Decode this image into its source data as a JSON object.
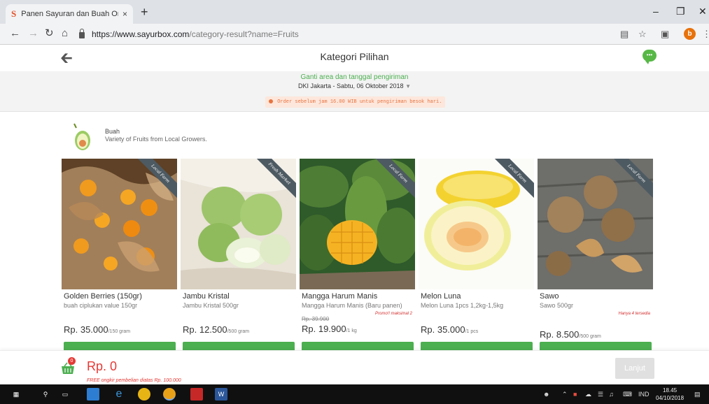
{
  "browser": {
    "tab_title": "Panen Sayuran dan Buah Organi",
    "tab_favicon": "S",
    "tab_close": "×",
    "new_tab": "+",
    "url_host": "https://www.sayurbox.com",
    "url_path": "/category-result?name=Fruits",
    "profile_initial": "b"
  },
  "header": {
    "title": "Kategori Pilihan"
  },
  "delivery": {
    "change_label": "Ganti area dan tanggal pengiriman",
    "location_date": "DKI Jakarta - Sabtu, 06 Oktober 2018",
    "notice": "Order sebelum jam 16.00 WIB untuk pengiriman besok hari."
  },
  "category": {
    "name": "Buah",
    "description": "Variety of Fruits from Local Growers."
  },
  "products": [
    {
      "badge": "Local Farm",
      "name": "Golden Berries (150gr)",
      "description": "buah ciplukan value 150gr",
      "price": "Rp. 35.000",
      "unit": "/150 gram"
    },
    {
      "badge": "Fresh Market",
      "name": "Jambu Kristal",
      "description": "Jambu Kristal 500gr",
      "price": "Rp. 12.500",
      "unit": "/500 gram"
    },
    {
      "badge": "Local Farm",
      "name": "Mangga Harum Manis",
      "description": "Mangga Harum Manis (Baru panen)",
      "promo": "Promo!! maksimal 2",
      "old_price": "Rp. 39.900",
      "price": "Rp. 19.900",
      "unit": "/1 kg"
    },
    {
      "badge": "Local Farm",
      "name": "Melon Luna",
      "description": "Melon Luna 1pcs 1,2kg-1,5kg",
      "price": "Rp. 35.000",
      "unit": "/1 pcs"
    },
    {
      "badge": "Local Farm",
      "name": "Sawo",
      "description": "Sawo 500gr",
      "promo": "Hanya 4 tersedia",
      "price": "Rp. 8.500",
      "unit": "/500 gram"
    }
  ],
  "cart": {
    "count": "0",
    "total": "Rp. 0",
    "free_shipping": "FREE ongkir pembelian diatas Rp. 100.000",
    "continue_label": "Lanjut"
  },
  "taskbar": {
    "language": "IND",
    "time": "18.45",
    "date": "04/10/2018"
  },
  "colors": {
    "brand_green": "#4caf50",
    "price_red": "#e53935",
    "notice_orange": "#e8733f",
    "ribbon": "#4d5a62"
  }
}
